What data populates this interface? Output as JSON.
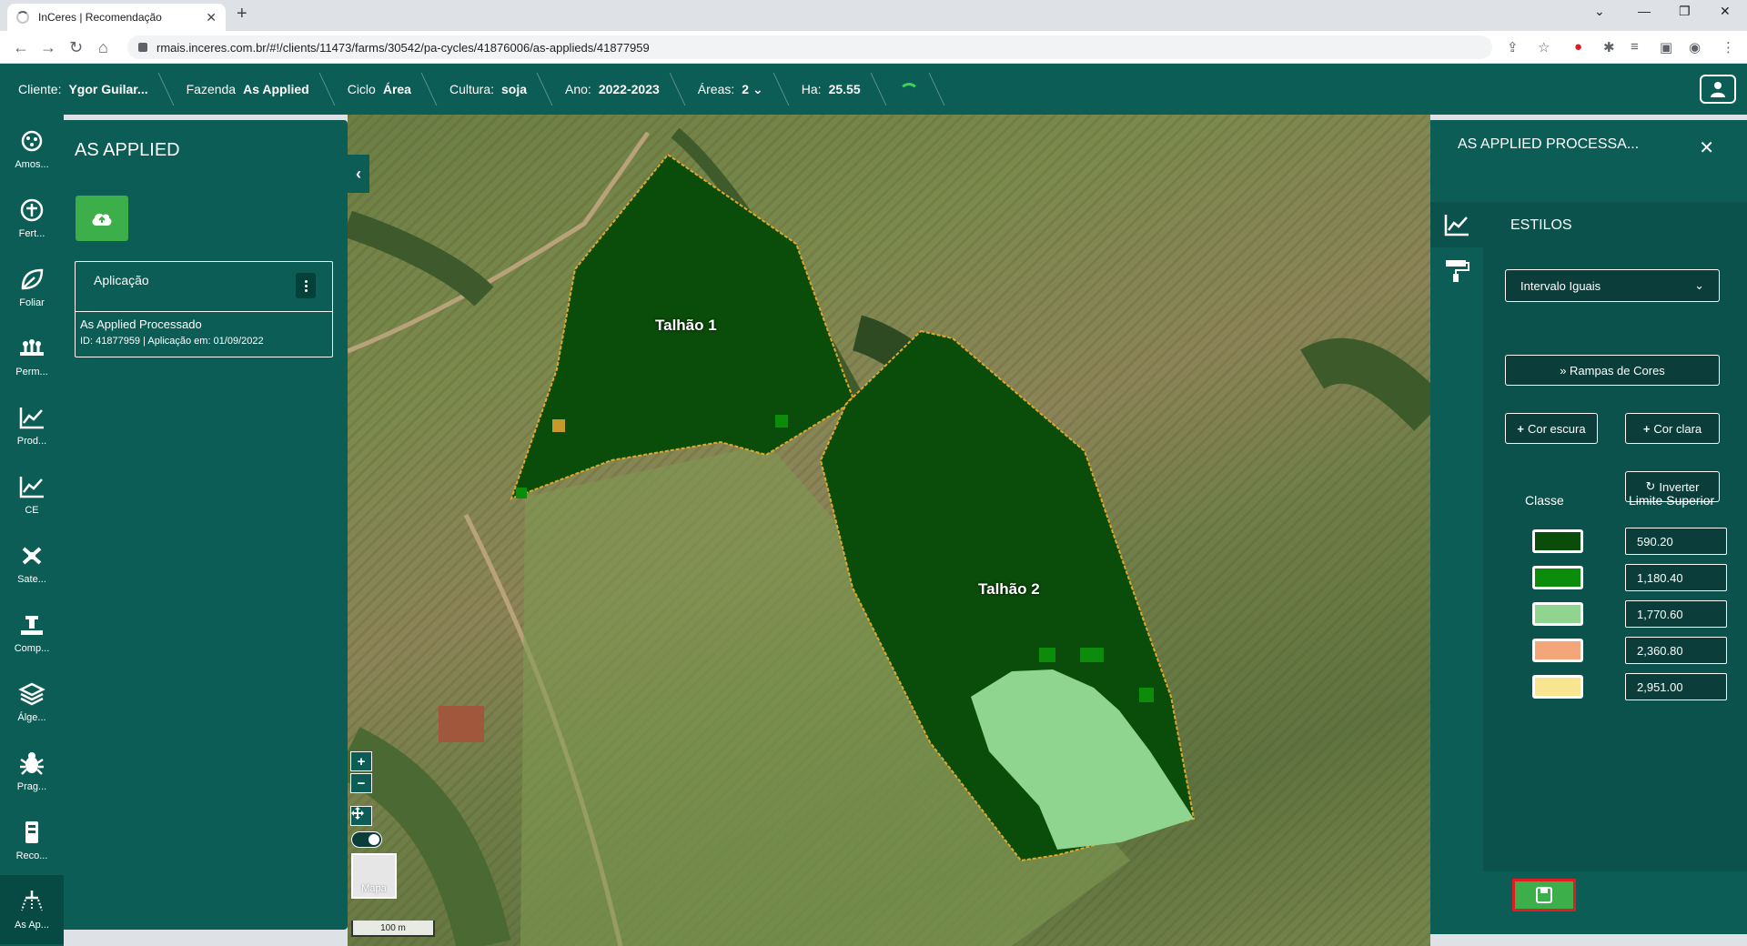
{
  "browser": {
    "tab_title": "InCeres | Recomendação",
    "url": "rmais.inceres.com.br/#!/clients/11473/farms/30542/pa-cycles/41876006/as-applieds/41877959"
  },
  "header": {
    "client_label": "Cliente:",
    "client_value": "Ygor Guilar...",
    "farm_label": "Fazenda",
    "farm_value": "As Applied",
    "cycle_label": "Ciclo",
    "cycle_value": "Área",
    "crop_label": "Cultura:",
    "crop_value": "soja",
    "year_label": "Ano:",
    "year_value": "2022-2023",
    "areas_label": "Áreas:",
    "areas_value": "2",
    "ha_label": "Ha:",
    "ha_value": "25.55"
  },
  "rail": [
    {
      "label": "Amos...",
      "icon": "sampling-icon"
    },
    {
      "label": "Fert...",
      "icon": "fertilizer-icon"
    },
    {
      "label": "Foliar",
      "icon": "leaf-icon"
    },
    {
      "label": "Perm...",
      "icon": "permanent-crop-icon"
    },
    {
      "label": "Prod...",
      "icon": "productivity-chart-icon"
    },
    {
      "label": "CE",
      "icon": "conductivity-chart-icon"
    },
    {
      "label": "Sate...",
      "icon": "satellite-icon"
    },
    {
      "label": "Comp...",
      "icon": "compaction-icon"
    },
    {
      "label": "Álge...",
      "icon": "layers-icon"
    },
    {
      "label": "Prag...",
      "icon": "bug-icon"
    },
    {
      "label": "Reco...",
      "icon": "recommendation-icon"
    },
    {
      "label": "As Ap...",
      "icon": "sprayer-icon"
    }
  ],
  "left_panel": {
    "title": "AS APPLIED",
    "card": {
      "header": "Aplicação",
      "name": "As Applied Processado",
      "meta": "ID: 41877959 | Aplicação em: 01/09/2022"
    }
  },
  "map": {
    "field1_label": "Talhão 1",
    "field2_label": "Talhão 2",
    "basemap_label": "Mapa",
    "scale_label": "100 m"
  },
  "right_panel": {
    "title": "AS APPLIED PROCESSA...",
    "section": "ESTILOS",
    "select_value": "Intervalo Iguais",
    "ramps_label": "Rampas de Cores",
    "dark_label": "Cor escura",
    "light_label": "Cor clara",
    "invert_label": "Inverter",
    "col_class": "Classe",
    "col_limit": "Limite Superior",
    "classes": [
      {
        "color": "#0a4d0a",
        "limit": "590.20"
      },
      {
        "color": "#0b8c0b",
        "limit": "1,180.40"
      },
      {
        "color": "#8fd48f",
        "limit": "1,770.60"
      },
      {
        "color": "#f4a57a",
        "limit": "2,360.80"
      },
      {
        "color": "#f7e58f",
        "limit": "2,951.00"
      }
    ]
  }
}
